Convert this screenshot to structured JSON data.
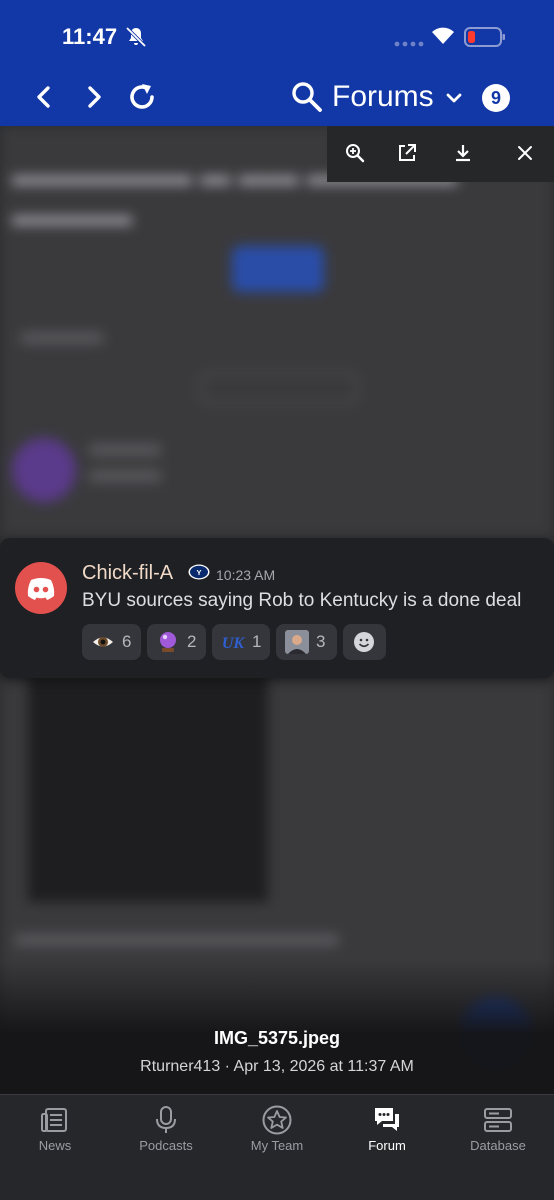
{
  "status_bar": {
    "time": "11:47"
  },
  "header": {
    "section": "Forums",
    "notification_count": "9"
  },
  "card": {
    "author": "Chick-fil-A",
    "time": "10:23 AM",
    "message": "BYU sources saying Rob to Kentucky is a done deal",
    "reactions": [
      {
        "icon": "eye-emoji",
        "count": "6"
      },
      {
        "icon": "crystal-ball-emoji",
        "count": "2"
      },
      {
        "icon": "kentucky-logo",
        "count": "1"
      },
      {
        "icon": "person-photo",
        "count": "3"
      }
    ]
  },
  "image": {
    "filename": "IMG_5375.jpeg",
    "meta": "Rturner413 · Apr 13, 2026 at 11:37 AM"
  },
  "tabs": [
    {
      "label": "News",
      "icon": "news-icon"
    },
    {
      "label": "Podcasts",
      "icon": "microphone-icon"
    },
    {
      "label": "My Team",
      "icon": "star-icon"
    },
    {
      "label": "Forum",
      "icon": "chat-icon",
      "active": true
    },
    {
      "label": "Database",
      "icon": "database-icon"
    }
  ],
  "colors": {
    "header": "#1237a6",
    "tabbar": "#26272b",
    "discord": "#e3514f"
  }
}
